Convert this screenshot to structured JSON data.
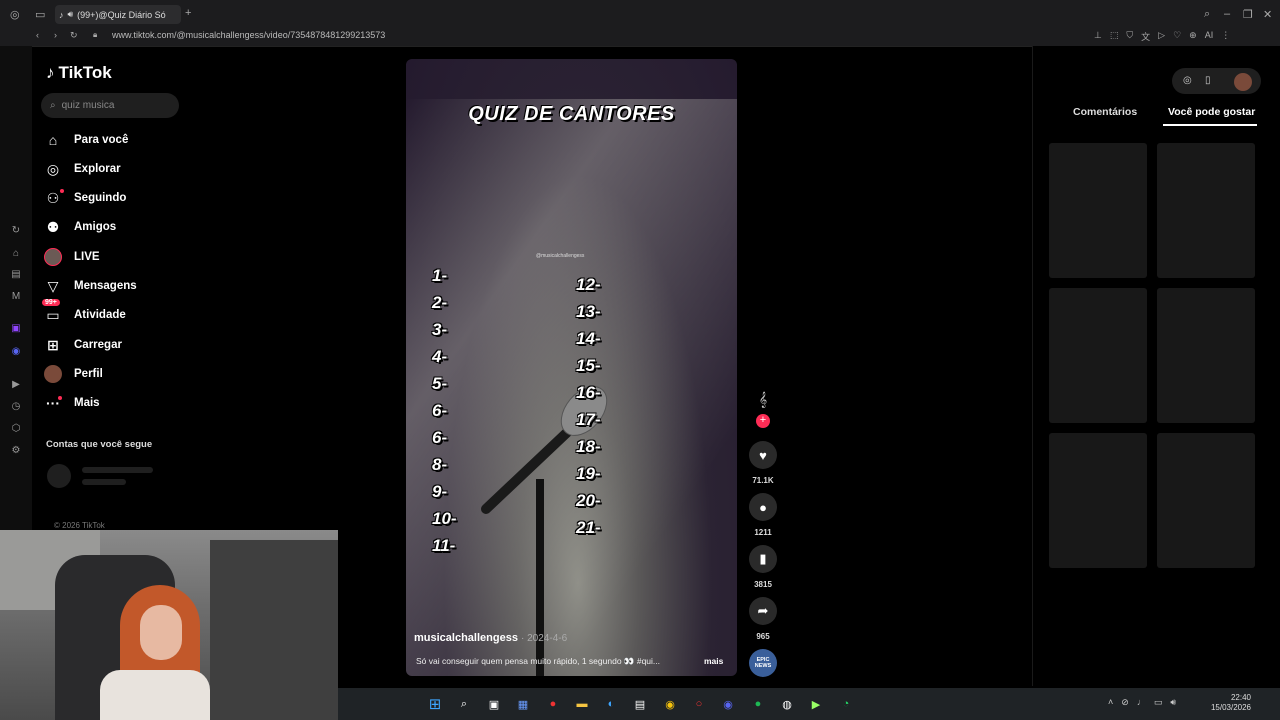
{
  "browser": {
    "tab_title": "(99+)@Quiz Diário Só",
    "url": "www.tiktok.com/@musicalchallengess/video/7354878481299213573",
    "ai_label": "AI"
  },
  "sidebar": {
    "logo": "TikTok",
    "search_placeholder": "quiz musica",
    "items": [
      {
        "label": "Para você",
        "icon": "home-icon"
      },
      {
        "label": "Explorar",
        "icon": "compass-icon"
      },
      {
        "label": "Seguindo",
        "icon": "following-icon"
      },
      {
        "label": "Amigos",
        "icon": "friends-icon"
      },
      {
        "label": "LIVE",
        "icon": "live-icon"
      },
      {
        "label": "Mensagens",
        "icon": "messages-icon"
      },
      {
        "label": "Atividade",
        "icon": "activity-icon",
        "badge": "99+"
      },
      {
        "label": "Carregar",
        "icon": "upload-icon"
      },
      {
        "label": "Perfil",
        "icon": "profile-avatar"
      },
      {
        "label": "Mais",
        "icon": "more-icon"
      }
    ],
    "following_header": "Contas que você segue",
    "copyright": "© 2026 TikTok"
  },
  "video": {
    "title": "QUIZ DE CANTORES",
    "watermark": "@musicalchallengess",
    "left_numbers": [
      "1-",
      "2-",
      "3-",
      "4-",
      "5-",
      "6-",
      "6-",
      "8-",
      "9-",
      "10-",
      "11-"
    ],
    "right_numbers": [
      "12-",
      "13-",
      "14-",
      "15-",
      "16-",
      "17-",
      "18-",
      "19-",
      "20-",
      "21-"
    ],
    "author": "musicalchallengess",
    "date": "· 2024-4-6",
    "caption": "Só vai conseguir quem pensa muito rápido, 1 segundo 👀 #qui...",
    "more": "mais"
  },
  "actions": {
    "likes": "71.1K",
    "comments": "1211",
    "saves": "3815",
    "shares": "965",
    "music_label": "EPIC NEWS"
  },
  "right_panel": {
    "tabs": [
      "Comentários",
      "Você pode gostar"
    ],
    "active_tab": "Você pode gostar"
  },
  "taskbar": {
    "time": "22:40",
    "date": "15/03/2026"
  },
  "colors": {
    "accent": "#fe2c55",
    "background": "#000000",
    "panel": "#1f1f1f"
  }
}
